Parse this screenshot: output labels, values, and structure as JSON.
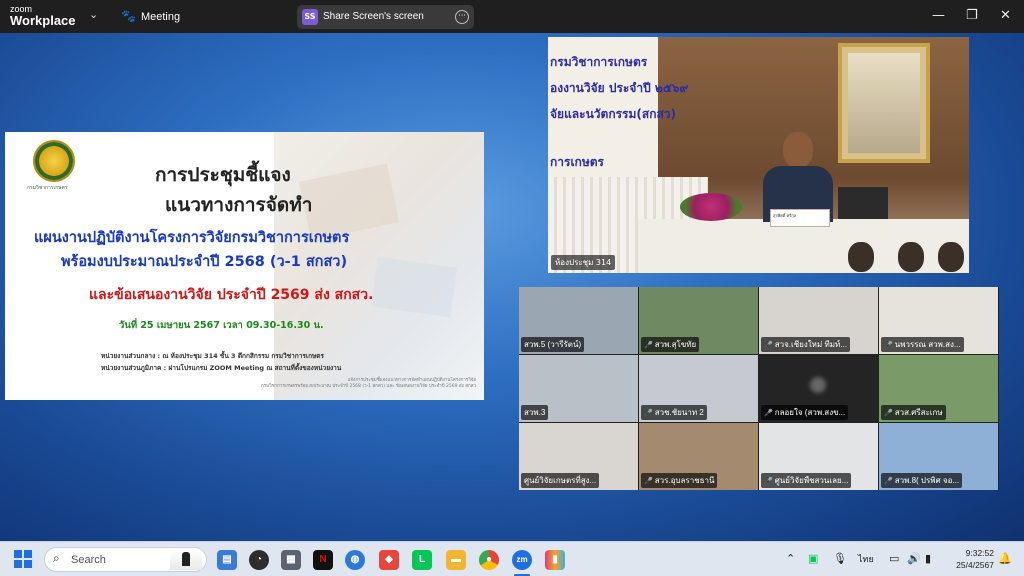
{
  "titlebar": {
    "app_line1": "zoom",
    "app_line2": "Workplace",
    "meeting_label": "Meeting",
    "share_badge": "SS",
    "share_label": "Share Screen's screen",
    "minimize": "—",
    "restore": "❐",
    "close": "✕"
  },
  "slide": {
    "emblem_caption": "กรมวิชาการเกษตร",
    "title_line1": "การประชุมชี้แจง",
    "title_line2": "แนวทางการจัดทำ",
    "plan_line1": "แผนงานปฏิบัติงานโครงการวิจัยกรมวิชาการเกษตร",
    "plan_line2": "พร้อมงบประมาณประจำปี 2568 (ว-1 สกสว)",
    "proposal_line": "และข้อเสนองานวิจัย ประจำปี 2569 ส่ง สกสว.",
    "date_line": "วันที่ 25 เมษายน 2567  เวลา 09.30-16.30 น.",
    "central_line": "หน่วยงานส่วนกลาง : ณ ห้องประชุม 314 ชั้น 3 ตึกกสิกรรม กรมวิชาการเกษตร",
    "regional_line": "หน่วยงานส่วนภูมิภาค : ผ่านโปรแกรม ZOOM Meeting ณ สถานที่ตั้งของหน่วยงาน",
    "footer_line1": "แจ้งการประชุมชี้แจงแนวทางการจัดทำแผนปฏิบัติงานโครงการวิจัย",
    "footer_line2": "กรมวิชาการเกษตรพร้อมงบประมาณ ประจำปี 2568 (ว-1 สกสว) และ ข้อเสนองานวิจัย ประจำปี 2569 ส่ง สกสว"
  },
  "speaker": {
    "banner_line1": "กรมวิชาการเกษตร",
    "banner_line2": "องงานวิจัย ประจำปี ๒๕๖๙",
    "banner_line3": "จัยและนวัตกรรม(สกสว)",
    "banner_line4": "การเกษตร",
    "nameplate": "สุรพิศดิ์ ศรีกุล",
    "label": "ห้องประชุม 314"
  },
  "gallery": {
    "tiles": [
      {
        "label": "สวพ.5 (วารีรัตน์)",
        "muted": false,
        "bg": "#9aa6b2"
      },
      {
        "label": "สวพ.สุโขทัย",
        "muted": true,
        "bg": "#6f8a62"
      },
      {
        "label": "สวจ.เชียงใหม่ ทีมท์...",
        "muted": true,
        "bg": "#d7d4d0"
      },
      {
        "label": "นพวรรณ สวพ.สง...",
        "muted": true,
        "bg": "#e6e3dd"
      },
      {
        "label": "สวพ.3",
        "muted": false,
        "bg": "#b9c0c8"
      },
      {
        "label": "สวช.ชัยนาท 2",
        "muted": true,
        "bg": "#c6cad0"
      },
      {
        "label": "กลอยใจ (สวพ.สงข...",
        "muted": true,
        "bg": "#242424"
      },
      {
        "label": "สวส.ศรีสะเกษ",
        "muted": true,
        "bg": "#7a9a68"
      },
      {
        "label": "ศูนย์วิจัยเกษตรที่สูง...",
        "muted": false,
        "bg": "#d9d6d2"
      },
      {
        "label": "สวร.อุบลราชธานี",
        "muted": true,
        "bg": "#a48a6e"
      },
      {
        "label": "ศูนย์วิจัยพืชสวนเลย...",
        "muted": true,
        "bg": "#e2e4e6"
      },
      {
        "label": "สวพ.8( ปรพิศ จอ...",
        "muted": true,
        "bg": "#8fb0d6"
      }
    ],
    "center_logo_caption": "ศูนย์วิจัยเกษตรที่สูงเพชรบูรณ์"
  },
  "taskbar": {
    "search_placeholder": "Search",
    "language": "ไทย",
    "time": "9:32:52",
    "date": "25/4/2567"
  },
  "colors": {
    "title_blue": "#1838c8",
    "title_red": "#d21515",
    "title_green": "#1a8a1a",
    "zoom_blue": "#1f6fe0"
  }
}
